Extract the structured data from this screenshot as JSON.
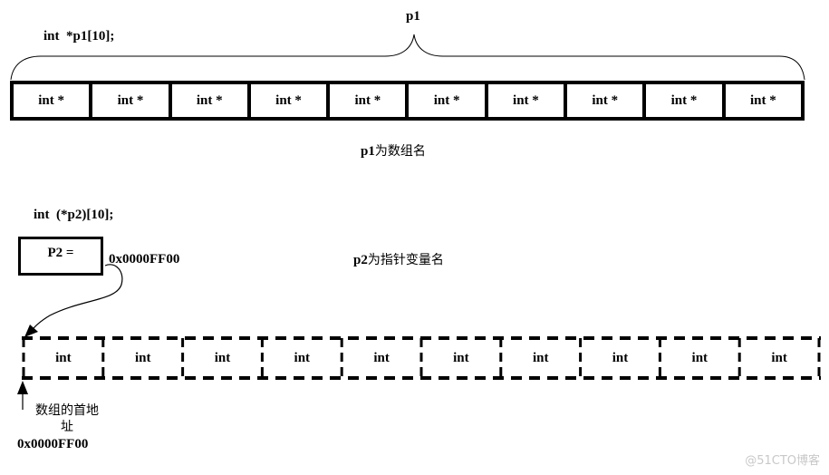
{
  "section1": {
    "declaration": "int  *p1[10];",
    "brace_label": "p1",
    "cells": [
      "int *",
      "int *",
      "int *",
      "int *",
      "int *",
      "int *",
      "int *",
      "int *",
      "int *",
      "int *"
    ],
    "caption_code": "p1",
    "caption_text": "为数组名"
  },
  "section2": {
    "declaration": "int  (*p2)[10];",
    "pointer_box_label": "P2 =",
    "pointer_value": "0x0000FF00",
    "caption_code": "p2",
    "caption_text": "为指针变量名",
    "cells": [
      "int",
      "int",
      "int",
      "int",
      "int",
      "int",
      "int",
      "int",
      "int",
      "int"
    ],
    "address_label_line1": "数组的首地",
    "address_label_line2": "址",
    "address_value": "0x0000FF00"
  },
  "watermark": "@51CTO博客"
}
